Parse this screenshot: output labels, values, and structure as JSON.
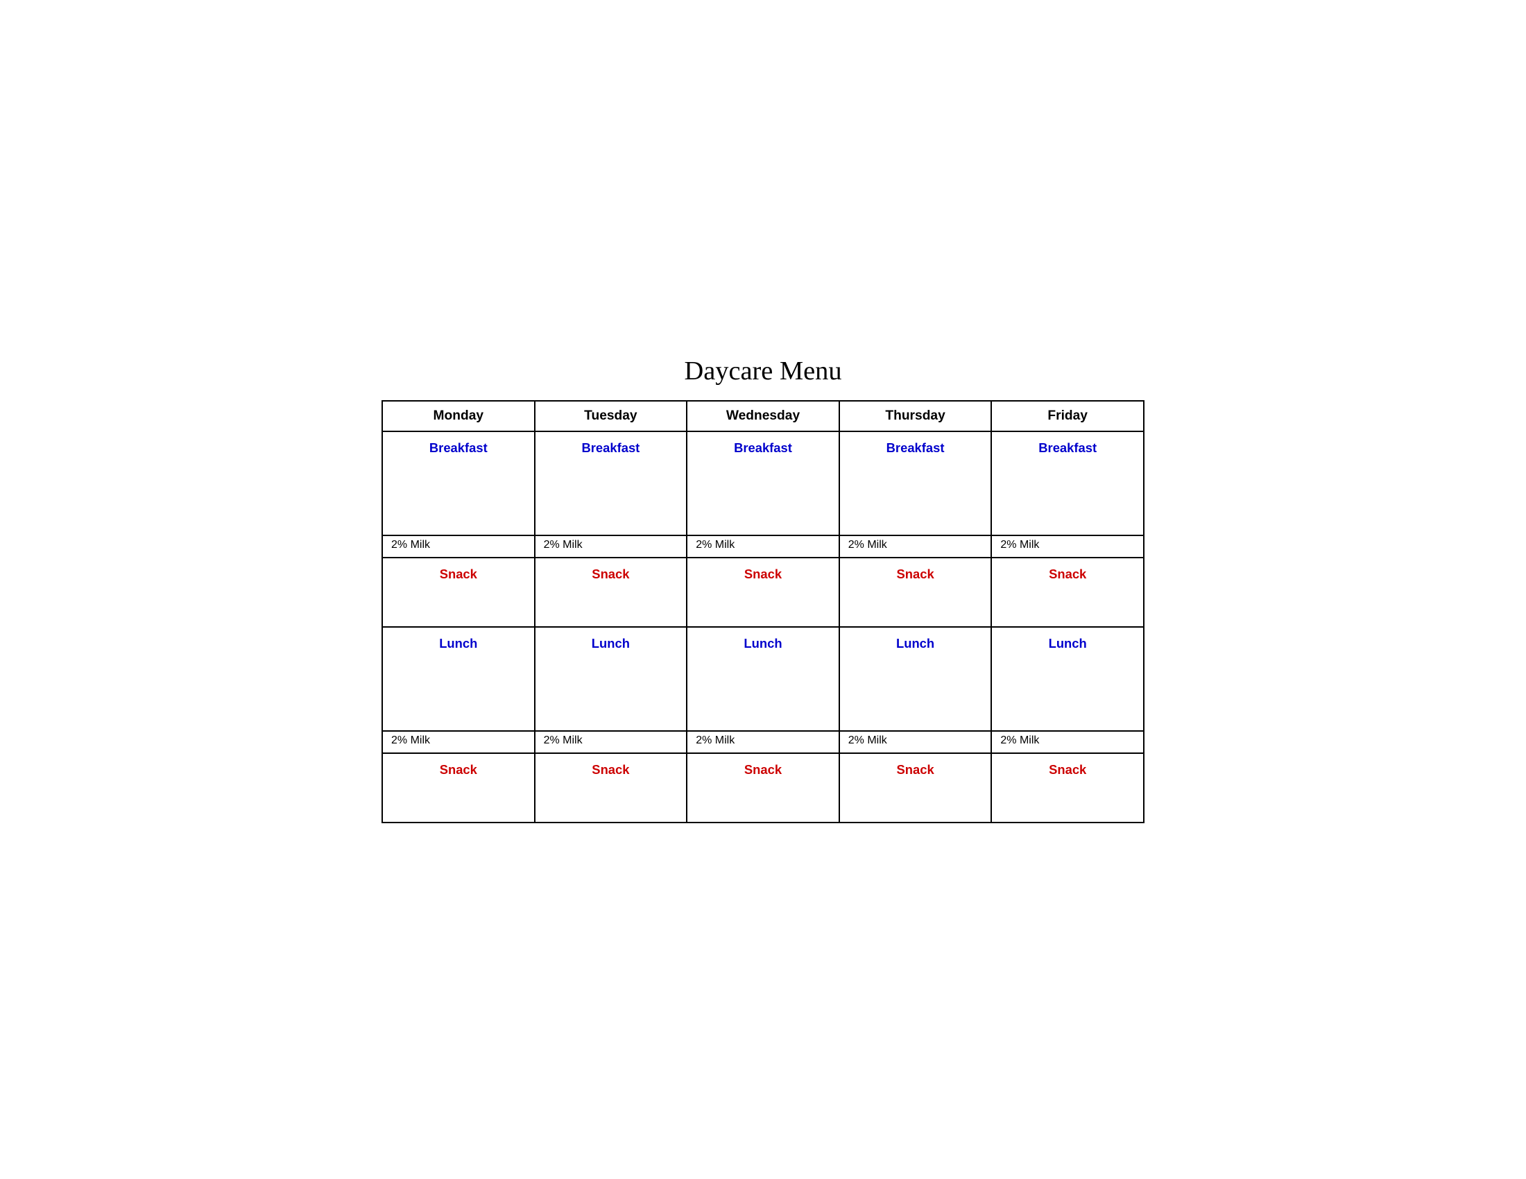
{
  "title": "Daycare Menu",
  "columns": [
    "Monday",
    "Tuesday",
    "Wednesday",
    "Thursday",
    "Friday"
  ],
  "rows": {
    "breakfast_label": "Breakfast",
    "milk1_label": "2% Milk",
    "snack1_label": "Snack",
    "lunch_label": "Lunch",
    "milk2_label": "2% Milk",
    "snack2_label": "Snack"
  },
  "colors": {
    "breakfast": "#0000cc",
    "snack": "#cc0000",
    "lunch": "#0000cc",
    "header_text": "#000000",
    "milk_text": "#000000",
    "title_text": "#000000",
    "border": "#000000"
  }
}
